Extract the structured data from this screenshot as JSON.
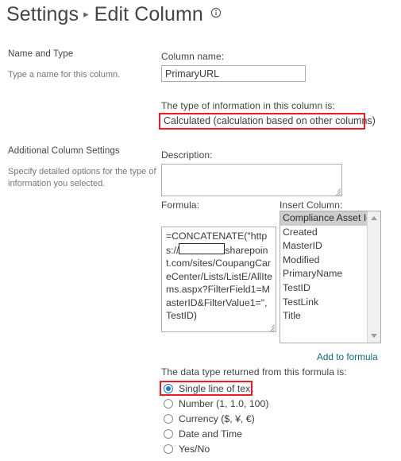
{
  "header": {
    "breadcrumb_root": "Settings",
    "separator": "▸",
    "breadcrumb_current": "Edit Column",
    "info_icon": "info-circle-icon"
  },
  "sections": [
    {
      "title": "Name and Type",
      "description": "Type a name for this column."
    },
    {
      "title": "Additional Column Settings",
      "description": "Specify detailed options for the type of information you selected."
    }
  ],
  "fields": {
    "column_name_label": "Column name:",
    "column_name_value": "PrimaryURL",
    "type_label": "The type of information in this column is:",
    "type_value": "Calculated (calculation based on other columns)",
    "description_label": "Description:",
    "description_value": "",
    "formula_label": "Formula:",
    "formula_part1": "=CONCATENATE(\"https://",
    "formula_redaction": "redacted-tenant-name",
    "formula_part2": "sharepoint.com/sites/CoupangCareCenter/Lists/ListE/AllItems.aspx?FilterField1=MasterID&FilterValue1=\",TestID)",
    "insert_column_label": "Insert Column:",
    "add_to_formula_link": "Add to formula",
    "data_type_label": "The data type returned from this formula is:"
  },
  "insert_columns": [
    {
      "label": "Compliance Asset Id",
      "selected": true
    },
    {
      "label": "Created",
      "selected": false
    },
    {
      "label": "MasterID",
      "selected": false
    },
    {
      "label": "Modified",
      "selected": false
    },
    {
      "label": "PrimaryName",
      "selected": false
    },
    {
      "label": "TestID",
      "selected": false
    },
    {
      "label": "TestLink",
      "selected": false
    },
    {
      "label": "Title",
      "selected": false
    }
  ],
  "scrollbar": {
    "up_arrow_icon": "scroll-up-arrow-icon",
    "down_arrow_icon": "scroll-down-arrow-icon"
  },
  "data_types": [
    {
      "label": "Single line of text",
      "checked": true
    },
    {
      "label": "Number (1, 1.0, 100)",
      "checked": false
    },
    {
      "label": "Currency ($, ¥, €)",
      "checked": false
    },
    {
      "label": "Date and Time",
      "checked": false
    },
    {
      "label": "Yes/No",
      "checked": false
    }
  ],
  "annotations": {
    "highlight_color": "#ee1c25",
    "boxes": [
      {
        "target": "type_value"
      },
      {
        "target": "single-line-of-text-radio"
      }
    ]
  },
  "colors": {
    "link": "#0f6a80",
    "radio_accent": "#1a7ad1",
    "selected_row": "#cdcdcd",
    "text": "#444444",
    "muted_text": "#767676"
  }
}
